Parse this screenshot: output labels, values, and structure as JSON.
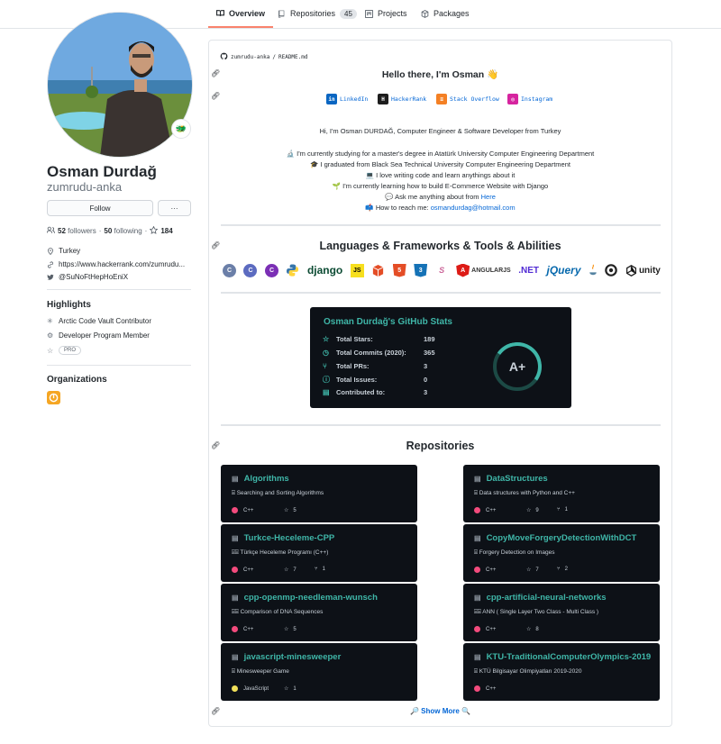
{
  "tabs": [
    {
      "label": "Overview",
      "icon": "book-icon",
      "active": true
    },
    {
      "label": "Repositories",
      "icon": "repo-icon",
      "count": "45"
    },
    {
      "label": "Projects",
      "icon": "project-icon"
    },
    {
      "label": "Packages",
      "icon": "package-icon"
    }
  ],
  "profile": {
    "full_name": "Osman Durdağ",
    "login": "zumrudu-anka",
    "status_emoji": "🐲",
    "follow_label": "Follow",
    "more_label": "···",
    "followers_count": "52",
    "followers_label": "followers",
    "following_count": "50",
    "following_label": "following",
    "stars_count": "184",
    "location": "Turkey",
    "website": "https://www.hackerrank.com/zumrudu...",
    "twitter": "@SuNoFtHepHoEniX"
  },
  "highlights": {
    "heading": "Highlights",
    "items": [
      "Arctic Code Vault Contributor",
      "Developer Program Member"
    ],
    "pro_badge": "PRO"
  },
  "organizations": {
    "heading": "Organizations"
  },
  "readme": {
    "path_user": "zumrudu-anka",
    "path_sep": "/",
    "path_file": "README.md",
    "hello": "Hello there, I'm Osman 👋",
    "social": [
      {
        "label": "LinkedIn",
        "badge": "in",
        "color": "#0a66c2"
      },
      {
        "label": "HackerRank",
        "badge": "H",
        "color": "#1d1d1d"
      },
      {
        "label": "Stack Overflow",
        "badge": "≡",
        "color": "#f48024"
      },
      {
        "label": "Instagram",
        "badge": "◎",
        "color": "#d6249f"
      }
    ],
    "intro_line": "Hi, I'm Osman DURDAĞ, Computer Engineer & Software Developer from Turkey",
    "bullets": [
      "🔬 I'm currently studying for a master's degree in Atatürk University Computer Engineering Department",
      "🎓 I graduated from Black Sea Technical University Computer Engineering Department",
      "💻 I love writing code and learn anythings about it",
      "🌱 I'm currently learning how to build E-Commerce Website with Django",
      "💬 Ask me anything about from"
    ],
    "ask_link": "Here",
    "reach_prefix": "📫 How to reach me:",
    "reach_email": "osmandurdag@hotmail.com",
    "tools_heading": "Languages & Frameworks & Tools & Abilities",
    "tools": [
      {
        "label": "C",
        "color": "#6b7fa8",
        "icon": "c-icon"
      },
      {
        "label": "C",
        "color": "#5c6bc0",
        "icon": "cpp-icon"
      },
      {
        "label": "C",
        "color": "#7b2fb5",
        "icon": "csharp-icon"
      },
      {
        "label": "",
        "color": "#4caf50",
        "icon": "python-icon"
      },
      {
        "label": "django",
        "color": "#0c4b33",
        "icon": "django-icon"
      },
      {
        "label": "JS",
        "color": "#f7df1e",
        "icon": "js-icon"
      },
      {
        "label": "",
        "color": "#e44d26",
        "icon": "box-icon"
      },
      {
        "label": "5",
        "color": "#e44d26",
        "icon": "html5-icon"
      },
      {
        "label": "3",
        "color": "#1572b6",
        "icon": "css3-icon"
      },
      {
        "label": "",
        "color": "#cc6699",
        "icon": "sass-icon"
      },
      {
        "label": "ANGULARJS",
        "color": "#dd1b16",
        "icon": "angular-icon"
      },
      {
        "label": ".NET",
        "color": "#512bd4",
        "icon": "dotnet-icon"
      },
      {
        "label": "jQuery",
        "color": "#0769ad",
        "icon": "jquery-icon"
      },
      {
        "label": "",
        "color": "#f89820",
        "icon": "java-icon"
      },
      {
        "label": "",
        "color": "#222222",
        "icon": "unity-circle-icon"
      },
      {
        "label": "unity",
        "color": "#222222",
        "icon": "unity-icon"
      }
    ],
    "stats_title": "Osman Durdağ's GitHub Stats",
    "stats": [
      {
        "label": "Total Stars:",
        "value": "189",
        "icon": "star-icon"
      },
      {
        "label": "Total Commits (2020):",
        "value": "365",
        "icon": "history-icon"
      },
      {
        "label": "Total PRs:",
        "value": "3",
        "icon": "pr-icon"
      },
      {
        "label": "Total Issues:",
        "value": "0",
        "icon": "issue-icon"
      },
      {
        "label": "Contributed to:",
        "value": "3",
        "icon": "repo-icon"
      }
    ],
    "rank": "A+",
    "repos_heading": "Repositories",
    "repos": [
      {
        "name": "Algorithms",
        "desc": "⌸ Searching and Sorting Algorithms",
        "lang": "C++",
        "lang_color": "#f34b7d",
        "stars": "5",
        "forks": ""
      },
      {
        "name": "DataStructures",
        "desc": "⌸ Data structures with Python and C++",
        "lang": "C++",
        "lang_color": "#f34b7d",
        "stars": "9",
        "forks": "1"
      },
      {
        "name": "Turkce-Heceleme-CPP",
        "desc": "⌸⌸ Türkçe Heceleme Programı (C++)",
        "lang": "C++",
        "lang_color": "#f34b7d",
        "stars": "7",
        "forks": "1"
      },
      {
        "name": "CopyMoveForgeryDetectionWithDCT",
        "desc": "⌸ Forgery Detection on Images",
        "lang": "C++",
        "lang_color": "#f34b7d",
        "stars": "7",
        "forks": "2"
      },
      {
        "name": "cpp-openmp-needleman-wunsch",
        "desc": "⌸⌸ Comparison of DNA Sequences",
        "lang": "C++",
        "lang_color": "#f34b7d",
        "stars": "5",
        "forks": ""
      },
      {
        "name": "cpp-artificial-neural-networks",
        "desc": "⌸⌸ ANN ( Single Layer Two Class - Multi Class )",
        "lang": "C++",
        "lang_color": "#f34b7d",
        "stars": "8",
        "forks": ""
      },
      {
        "name": "javascript-minesweeper",
        "desc": "⌸ Minesweeper Game",
        "lang": "JavaScript",
        "lang_color": "#f1e05a",
        "stars": "1",
        "forks": ""
      },
      {
        "name": "KTU-TraditionalComputerOlympics-2019",
        "desc": "⌸ KTÜ Bilgisayar Olimpiyatları 2019-2020",
        "lang": "C++",
        "lang_color": "#f34b7d",
        "stars": "",
        "forks": ""
      }
    ],
    "show_more": "🔎 Show More 🔍"
  }
}
